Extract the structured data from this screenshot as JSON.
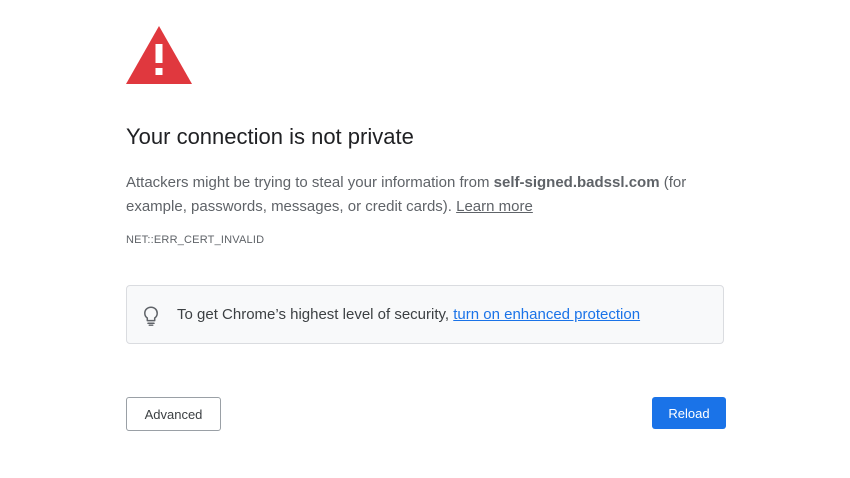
{
  "interstitial": {
    "icon": "warning-triangle-icon",
    "icon_color": "#e0383e",
    "title": "Your connection is not private",
    "description": {
      "before_host": "Attackers might be trying to steal your information from ",
      "host": "self-signed.badssl.com",
      "after_host": " (for example, passwords, messages, or credit cards). ",
      "learn_more": "Learn more"
    },
    "error_code": "NET::ERR_CERT_INVALID"
  },
  "promo": {
    "icon": "lightbulb-icon",
    "text": "To get Chrome’s highest level of security, ",
    "link": "turn on enhanced protection"
  },
  "buttons": {
    "advanced_label": "Advanced",
    "reload_label": "Reload",
    "reload_color": "#1a73e8"
  }
}
